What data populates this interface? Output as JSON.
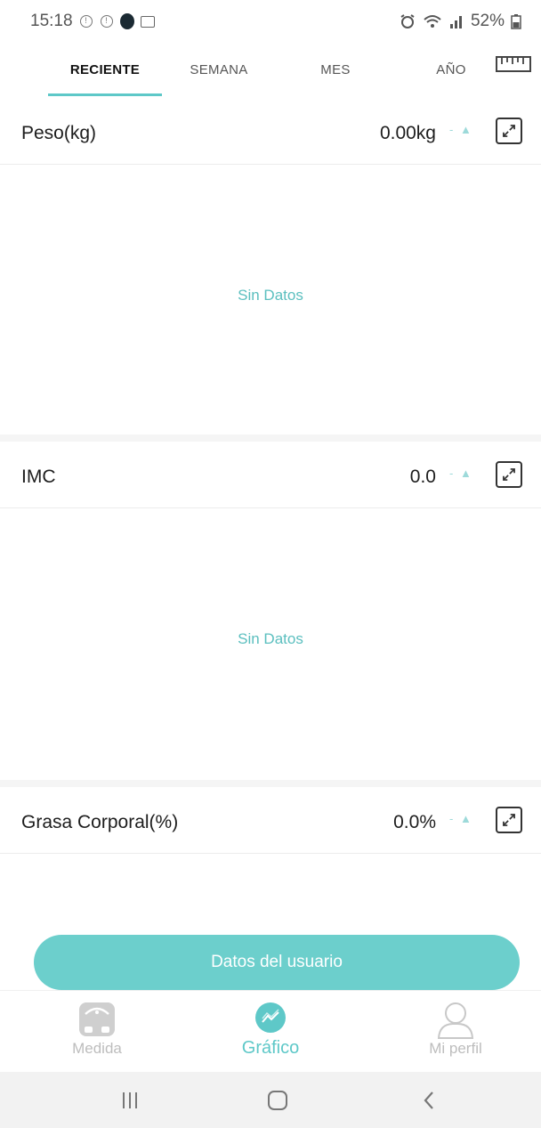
{
  "status_bar": {
    "time": "15:18",
    "battery": "52%"
  },
  "tabs": [
    {
      "label": "RECIENTE"
    },
    {
      "label": "SEMANA"
    },
    {
      "label": "MES"
    },
    {
      "label": "AÑO"
    }
  ],
  "cards": [
    {
      "title": "Peso(kg)",
      "value": "0.00kg",
      "empty_text": "Sin Datos"
    },
    {
      "title": "IMC",
      "value": "0.0",
      "empty_text": "Sin Datos"
    },
    {
      "title": "Grasa Corporal(%)",
      "value": "0.0%"
    }
  ],
  "user_button": {
    "label": "Datos del usuario"
  },
  "bottom_nav": [
    {
      "label": "Medida",
      "icon": "scale-icon"
    },
    {
      "label": "Gráfico",
      "icon": "chart-icon"
    },
    {
      "label": "Mi perfil",
      "icon": "person-icon"
    }
  ],
  "colors": {
    "accent": "#5ec8c8",
    "button": "#6ccfcc",
    "inactive": "#bdbdbd"
  }
}
